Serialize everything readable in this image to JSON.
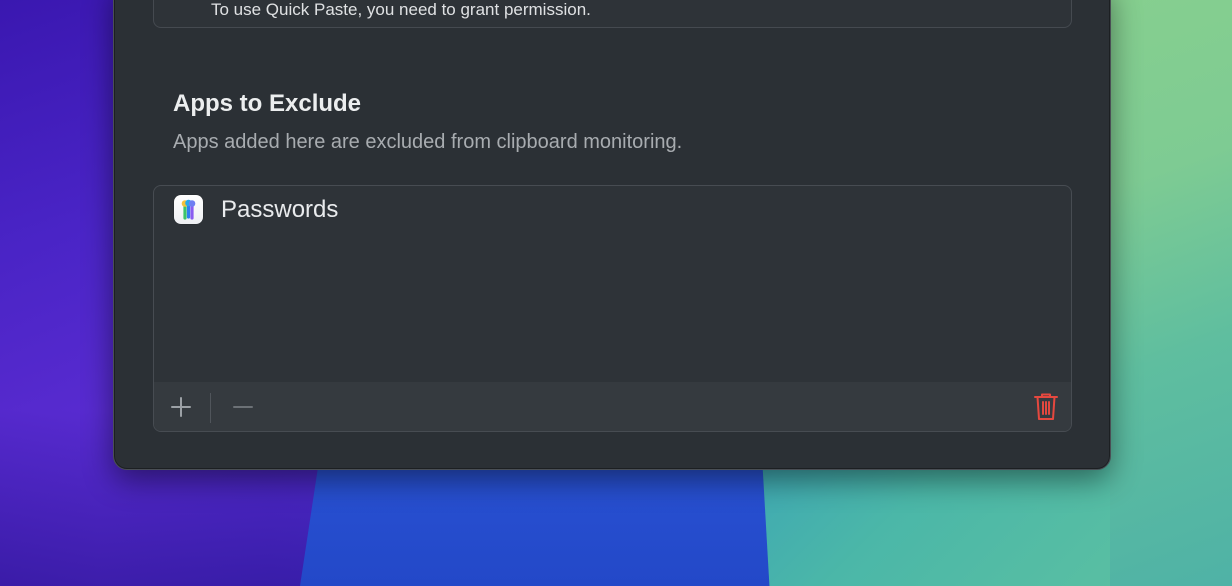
{
  "top_box": {
    "text": "To use Quick Paste, you need to grant permission."
  },
  "exclude_section": {
    "title": "Apps to Exclude",
    "description": "Apps added here are excluded from clipboard monitoring."
  },
  "excluded_apps": [
    {
      "name": "Passwords",
      "icon": "passwords-app-icon"
    }
  ],
  "toolbar": {
    "add_icon": "plus-icon",
    "remove_icon": "minus-icon",
    "delete_icon": "trash-icon"
  },
  "colors": {
    "delete_accent": "#e5483f",
    "window_background": "#2b3035",
    "toolbar_background": "#353a3f"
  }
}
